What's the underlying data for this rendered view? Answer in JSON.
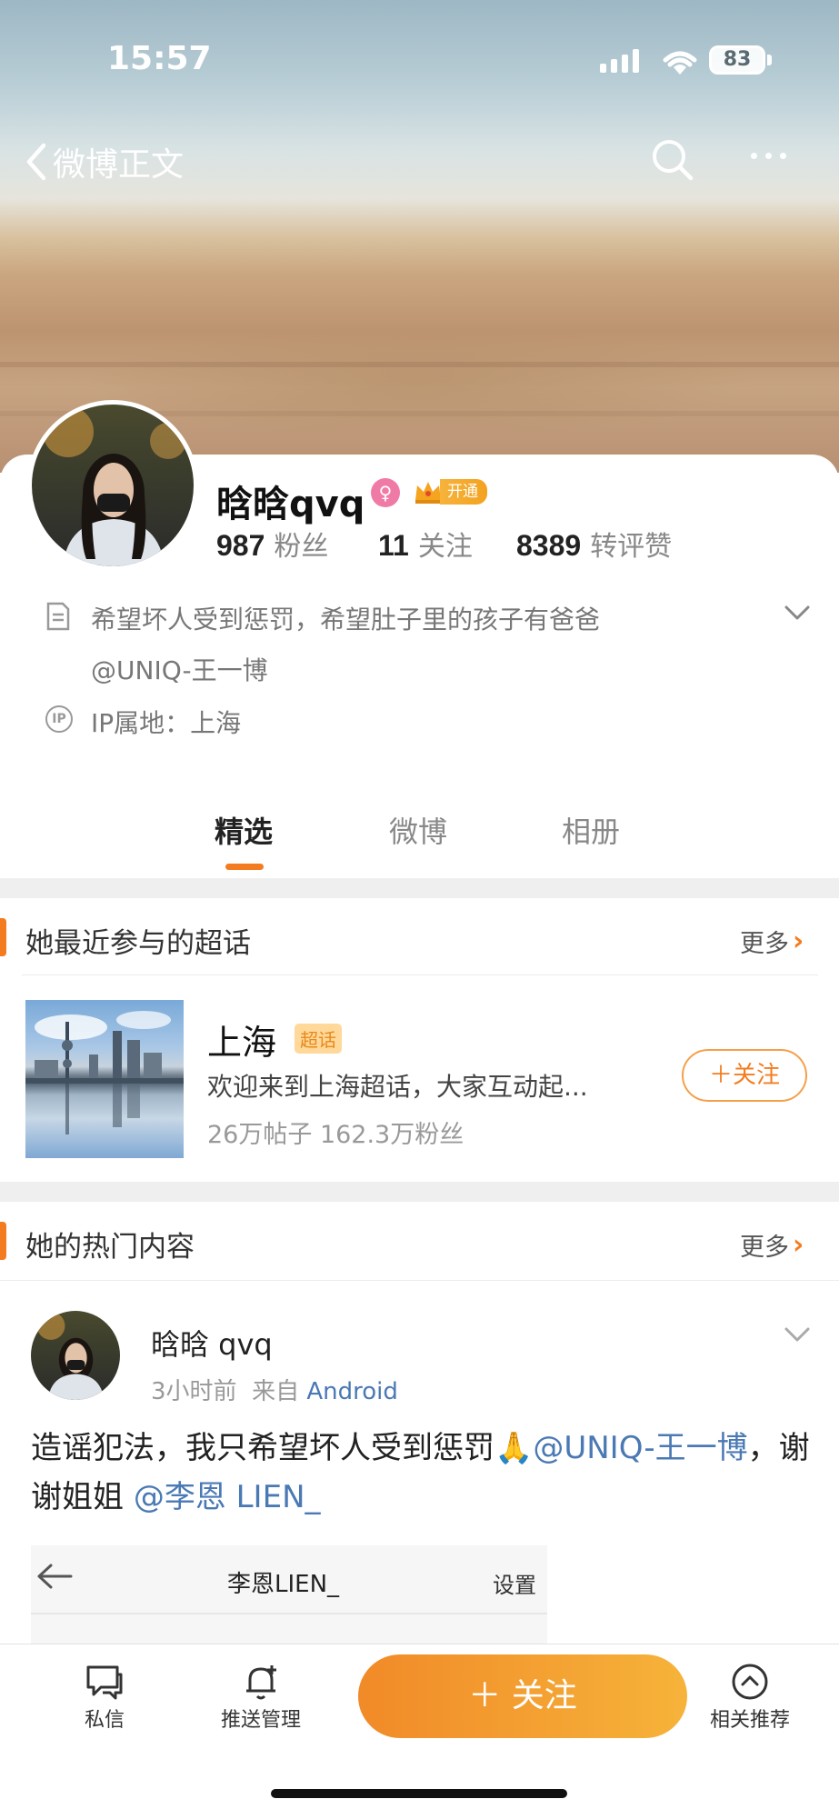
{
  "status_bar": {
    "time": "15:57",
    "battery": "83"
  },
  "nav": {
    "back_label": "微博正文"
  },
  "profile": {
    "name": "晗晗qvq",
    "vip_label": "开通",
    "stats": [
      {
        "value": "987",
        "label": "粉丝"
      },
      {
        "value": "11",
        "label": "关注"
      },
      {
        "value": "8389",
        "label": "转评赞"
      }
    ],
    "bio_line1": "希望坏人受到惩罚，希望肚子里的孩子有爸爸",
    "bio_line2": "@UNIQ-王一博",
    "ip": "IP属地：上海"
  },
  "tabs": [
    {
      "label": "精选"
    },
    {
      "label": "微博"
    },
    {
      "label": "相册"
    }
  ],
  "super_topics": {
    "title": "她最近参与的超话",
    "more": "更多",
    "item": {
      "name": "上海",
      "badge": "超话",
      "desc": "欢迎来到上海超话，大家互动起...",
      "stats": "26万帖子  162.3万粉丝",
      "follow": "＋关注"
    }
  },
  "hot": {
    "title": "她的热门内容",
    "more": "更多",
    "post": {
      "author": "晗晗 qvq",
      "time": "3小时前",
      "source_prefix": "来自",
      "source": "Android",
      "text_part1": "造谣犯法，我只希望坏人受到惩罚",
      "emoji": "🙏",
      "mention1": "@UNIQ-王一博",
      "text_part2": "，谢谢姐姐",
      "mention2": "@李恩 LIEN_",
      "embed_title": "李恩LIEN_",
      "embed_settings": "设置"
    }
  },
  "bottom_bar": {
    "message": "私信",
    "push": "推送管理",
    "follow": "＋ 关注",
    "recommend": "相关推荐"
  },
  "colors": {
    "accent": "#f47c20",
    "link": "#4a79b4"
  }
}
